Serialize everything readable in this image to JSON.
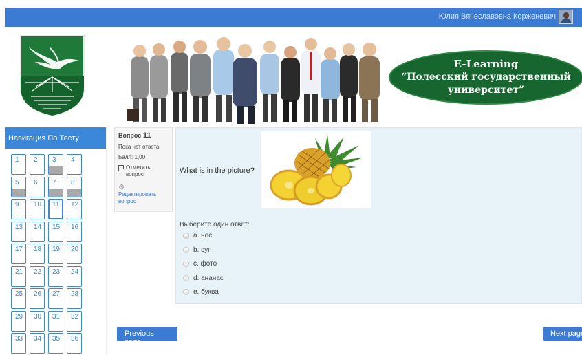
{
  "topbar": {
    "user_name": "Юлия Вячеславовна Корженевич",
    "avatar_icon": "user-avatar"
  },
  "banner": {
    "title": "E-Learning",
    "subtitle": "“Полесский государственный\nуниверситет”"
  },
  "nav": {
    "header": "Навигация По Тесту",
    "buttons": [
      {
        "label": "1",
        "answered": false,
        "current": false
      },
      {
        "label": "2",
        "answered": false,
        "current": false
      },
      {
        "label": "3",
        "answered": true,
        "current": false
      },
      {
        "label": "4",
        "answered": false,
        "current": false
      },
      {
        "label": "5",
        "answered": true,
        "current": false
      },
      {
        "label": "6",
        "answered": false,
        "current": false
      },
      {
        "label": "7",
        "answered": true,
        "current": false
      },
      {
        "label": "8",
        "answered": true,
        "current": false
      },
      {
        "label": "9",
        "answered": false,
        "current": false
      },
      {
        "label": "10",
        "answered": false,
        "current": false
      },
      {
        "label": "11",
        "answered": false,
        "current": true
      },
      {
        "label": "12",
        "answered": false,
        "current": false
      },
      {
        "label": "13",
        "answered": false,
        "current": false
      },
      {
        "label": "14",
        "answered": false,
        "current": false
      },
      {
        "label": "15",
        "answered": false,
        "current": false
      },
      {
        "label": "16",
        "answered": false,
        "current": false
      },
      {
        "label": "17",
        "answered": false,
        "current": false
      },
      {
        "label": "18",
        "answered": false,
        "current": false
      },
      {
        "label": "19",
        "answered": false,
        "current": false
      },
      {
        "label": "20",
        "answered": false,
        "current": false
      },
      {
        "label": "21",
        "answered": false,
        "current": false
      },
      {
        "label": "22",
        "answered": false,
        "current": false
      },
      {
        "label": "23",
        "answered": false,
        "current": false
      },
      {
        "label": "24",
        "answered": false,
        "current": false
      },
      {
        "label": "25",
        "answered": false,
        "current": false
      },
      {
        "label": "26",
        "answered": false,
        "current": false
      },
      {
        "label": "27",
        "answered": false,
        "current": false
      },
      {
        "label": "28",
        "answered": false,
        "current": false
      },
      {
        "label": "29",
        "answered": false,
        "current": false
      },
      {
        "label": "30",
        "answered": false,
        "current": false
      },
      {
        "label": "31",
        "answered": false,
        "current": false
      },
      {
        "label": "32",
        "answered": false,
        "current": false
      },
      {
        "label": "33",
        "answered": false,
        "current": false
      },
      {
        "label": "34",
        "answered": false,
        "current": false
      },
      {
        "label": "35",
        "answered": false,
        "current": false
      },
      {
        "label": "36",
        "answered": false,
        "current": false
      }
    ]
  },
  "question_info": {
    "prefix": "Вопрос",
    "number": "11",
    "status": "Пока нет ответа",
    "score": "Балл: 1,00",
    "flag_label": "Отметить вопрос",
    "edit_label": "Редактировать вопрос"
  },
  "question": {
    "text": "What is in the picture?",
    "prompt": "Выберите один ответ:",
    "answers": [
      {
        "label": "a. нос"
      },
      {
        "label": "b. суп"
      },
      {
        "label": "c. фото"
      },
      {
        "label": "d. ананас"
      },
      {
        "label": "e. буква"
      }
    ]
  },
  "pager": {
    "prev": "Previous page",
    "next": "Next page"
  },
  "colors": {
    "accent": "#3b7bd4",
    "nav_accent": "#3b88da",
    "banner_green": "#17652f",
    "question_bg": "#e7f3f8"
  }
}
